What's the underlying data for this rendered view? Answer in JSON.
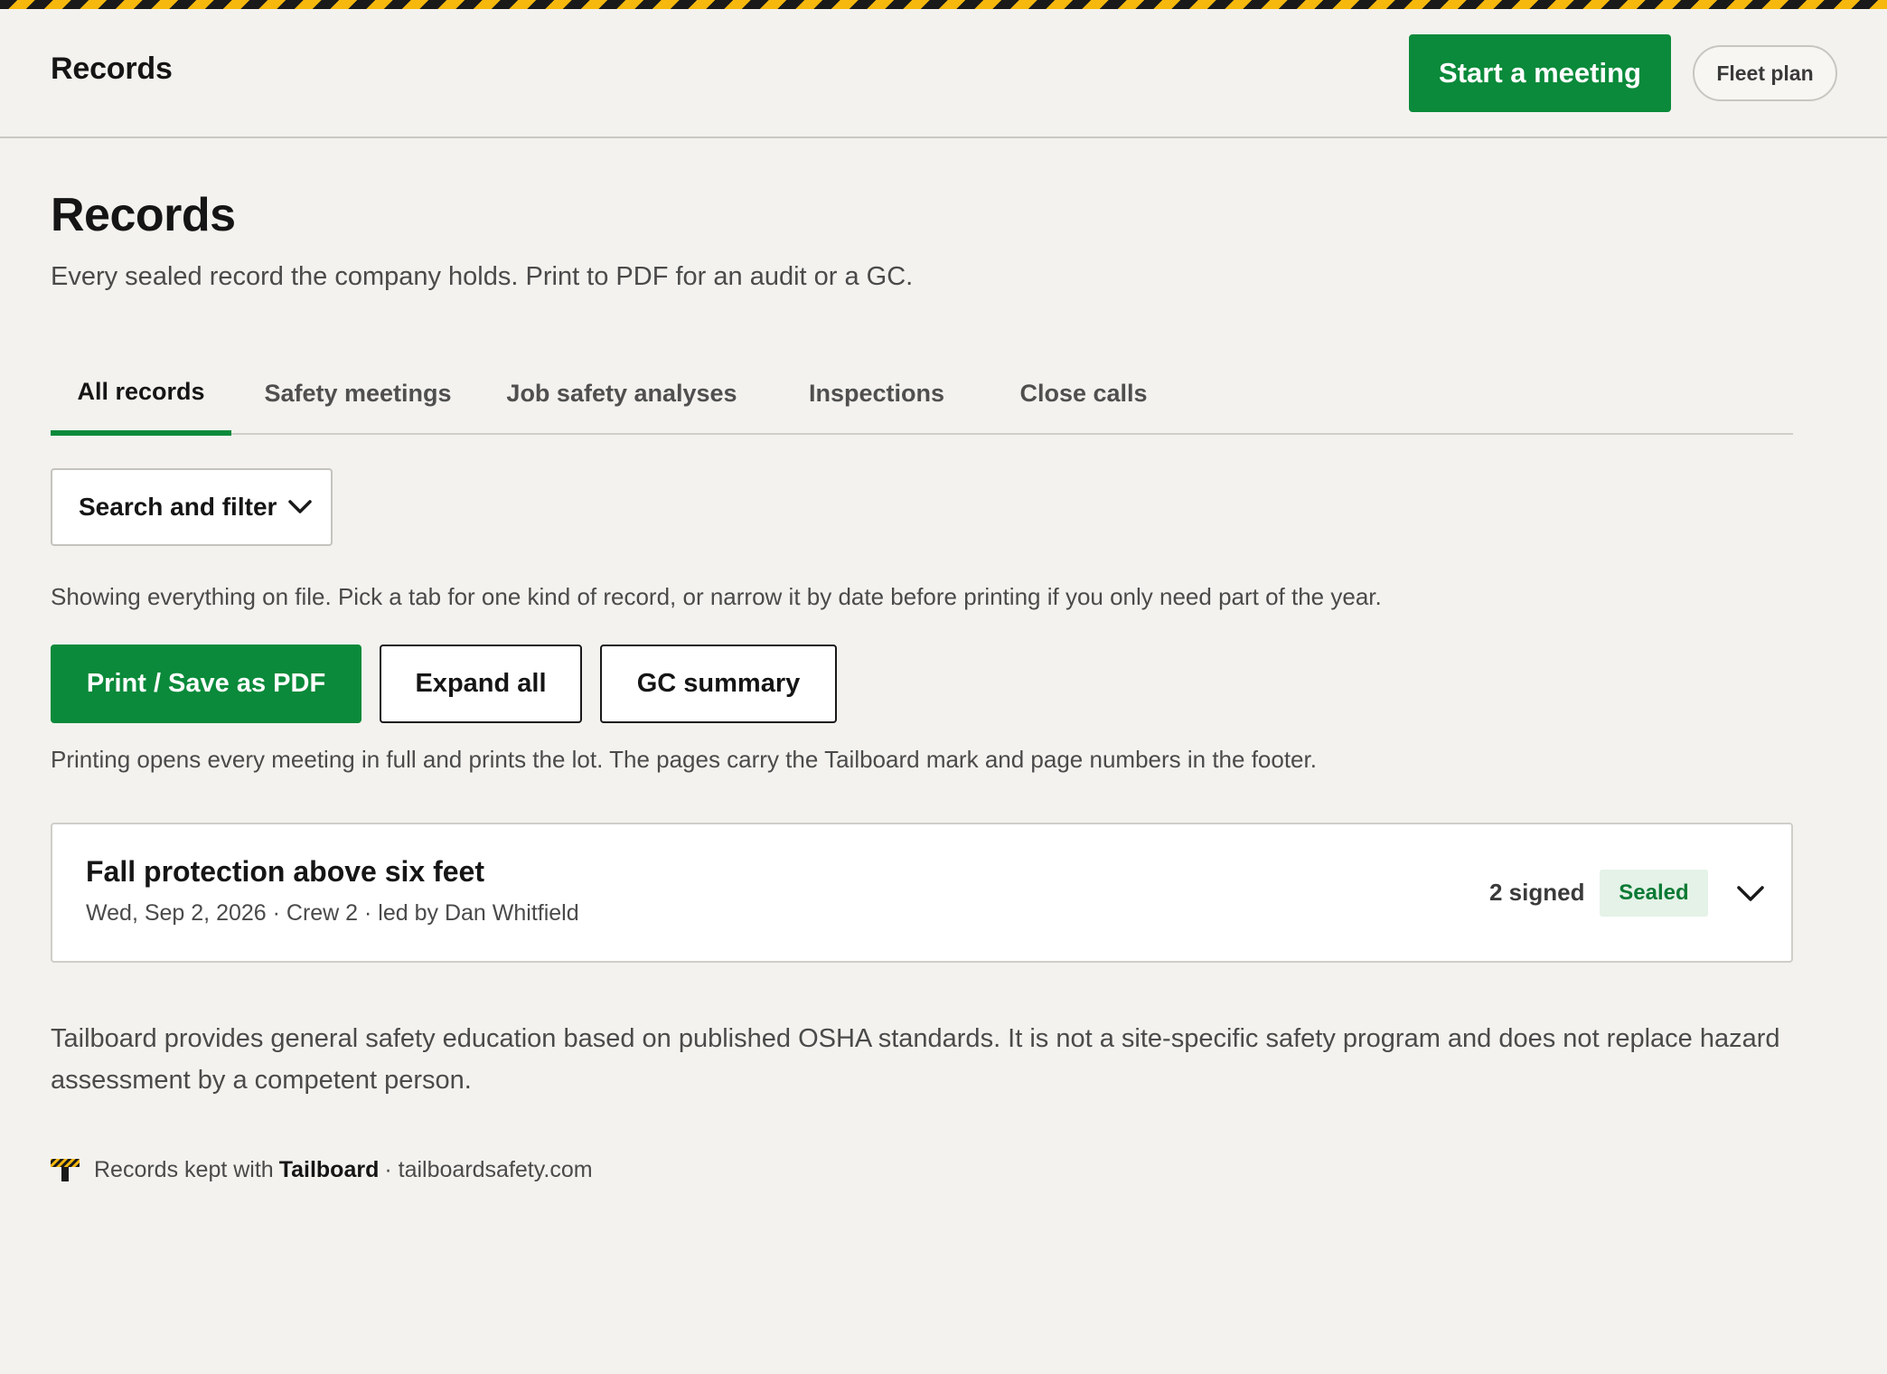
{
  "header": {
    "title": "Records",
    "start_meeting_label": "Start a meeting",
    "fleet_plan_label": "Fleet plan"
  },
  "page": {
    "title": "Records",
    "subtitle": "Every sealed record the company holds. Print to PDF for an audit or a GC."
  },
  "tabs": [
    {
      "label": "All records",
      "active": true
    },
    {
      "label": "Safety meetings",
      "active": false
    },
    {
      "label": "Job safety analyses",
      "active": false
    },
    {
      "label": "Inspections",
      "active": false
    },
    {
      "label": "Close calls",
      "active": false
    }
  ],
  "filter": {
    "label": "Search and filter",
    "icon": "chevron-down-icon"
  },
  "scope_note": "Showing everything on file. Pick a tab for one kind of record, or narrow it by date before printing if you only need part of the year.",
  "actions": {
    "print_label": "Print / Save as PDF",
    "expand_label": "Expand all",
    "gc_summary_label": "GC summary"
  },
  "print_note": "Printing opens every meeting in full and prints the lot. The pages carry the Tailboard mark and page numbers in the footer.",
  "records": [
    {
      "title": "Fall protection above six feet",
      "meta": "Wed, Sep 2, 2026 · Crew 2 · led by Dan Whitfield",
      "signed": "2 signed",
      "status": "Sealed"
    }
  ],
  "disclaimer": "Tailboard provides general safety education based on published OSHA standards. It is not a site-specific safety program and does not replace hazard assessment by a competent person.",
  "footer": {
    "prefix": "Records kept with",
    "brand": "Tailboard",
    "suffix": "· tailboardsafety.com"
  },
  "colors": {
    "accent_green": "#0a8a3a",
    "hazard_yellow": "#f6b80d",
    "hazard_black": "#1a1a1a",
    "background": "#f3f2ee",
    "badge_bg": "#e4f2e7"
  }
}
